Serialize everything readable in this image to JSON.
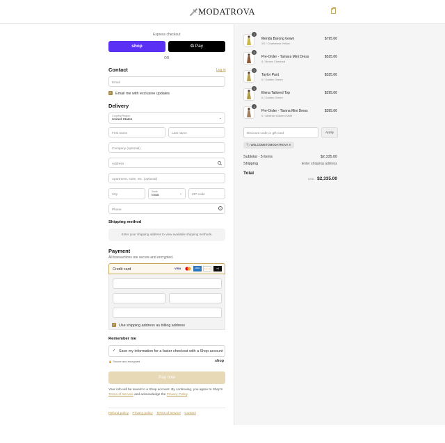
{
  "header": {
    "logo": "MODATROVA",
    "bag_icon": "shopping-bag-icon"
  },
  "express": {
    "label": "Express checkout",
    "shop_label": "shop",
    "gpay_label": "Pay",
    "or": "OR"
  },
  "contact": {
    "title": "Contact",
    "login": "Log in",
    "email_placeholder": "Email",
    "email_updates": "Email me with exclusive updates",
    "email_updates_checked": true
  },
  "delivery": {
    "title": "Delivery",
    "country_label": "Country/Region",
    "country_value": "United States",
    "first_name": "First name",
    "last_name": "Last name",
    "company": "Company (optional)",
    "address": "Address",
    "apartment": "Apartment, suite, etc. (optional)",
    "city": "City",
    "state_label": "State",
    "state_value": "Iowa",
    "zip": "ZIP code",
    "phone": "Phone"
  },
  "shipping": {
    "title": "Shipping method",
    "message": "Enter your shipping address to view available shipping methods."
  },
  "payment": {
    "title": "Payment",
    "subtitle": "All transactions are secure and encrypted.",
    "method": "Credit card",
    "cards": [
      "VISA",
      "MC",
      "AMEX",
      "DISCOVER",
      "+4"
    ],
    "billing_same": "Use shipping address as billing address",
    "billing_checked": true
  },
  "remember": {
    "title": "Remember me",
    "save_info": "Save my information for a faster checkout with a Shop account",
    "secure": "Secure and encrypted",
    "shop": "shop"
  },
  "pay_button": "Pay now",
  "legal": {
    "line1": "Your info will be saved to a Shop account. By continuing, you agree to Shop's",
    "terms": "Terms of Service",
    "mid": "and acknowledge the",
    "privacy": "Privacy Policy",
    "end": "."
  },
  "footer_links": [
    "Refund policy",
    "Privacy policy",
    "Terms of service",
    "Contact"
  ],
  "cart": {
    "items": [
      {
        "qty": "1",
        "name": "Merida Barong Gown",
        "variant": "XS / Chartreuse Yellow",
        "price": "$795.00",
        "color": "#c9b84a"
      },
      {
        "qty": "1",
        "name": "Pre-Order - Tamara Mini Dress",
        "variant": "0 / Brown Chestnut",
        "price": "$525.00",
        "color": "#8a5a3a"
      },
      {
        "qty": "1",
        "name": "Taylor Pant",
        "variant": "0 / Golden Green",
        "price": "$325.00",
        "color": "#b8a04a"
      },
      {
        "qty": "1",
        "name": "Elena Tailored Top",
        "variant": "0 / Golden Green",
        "price": "$295.00",
        "color": "#b09a48"
      },
      {
        "qty": "1",
        "name": "Pre-Order - Tianna Mini Dress",
        "variant": "0 / Abstract Autumn Multi",
        "price": "$395.00",
        "color": "#a37f62"
      }
    ],
    "discount_placeholder": "Discount code or gift card",
    "apply": "Apply",
    "code": "WELCOMETOMODATROVA",
    "subtotal_label": "Subtotal · 5 items",
    "subtotal": "$2,335.00",
    "shipping_label": "Shipping",
    "shipping_value": "Enter shipping address",
    "total_label": "Total",
    "currency": "USD",
    "total": "$2,335.00"
  }
}
